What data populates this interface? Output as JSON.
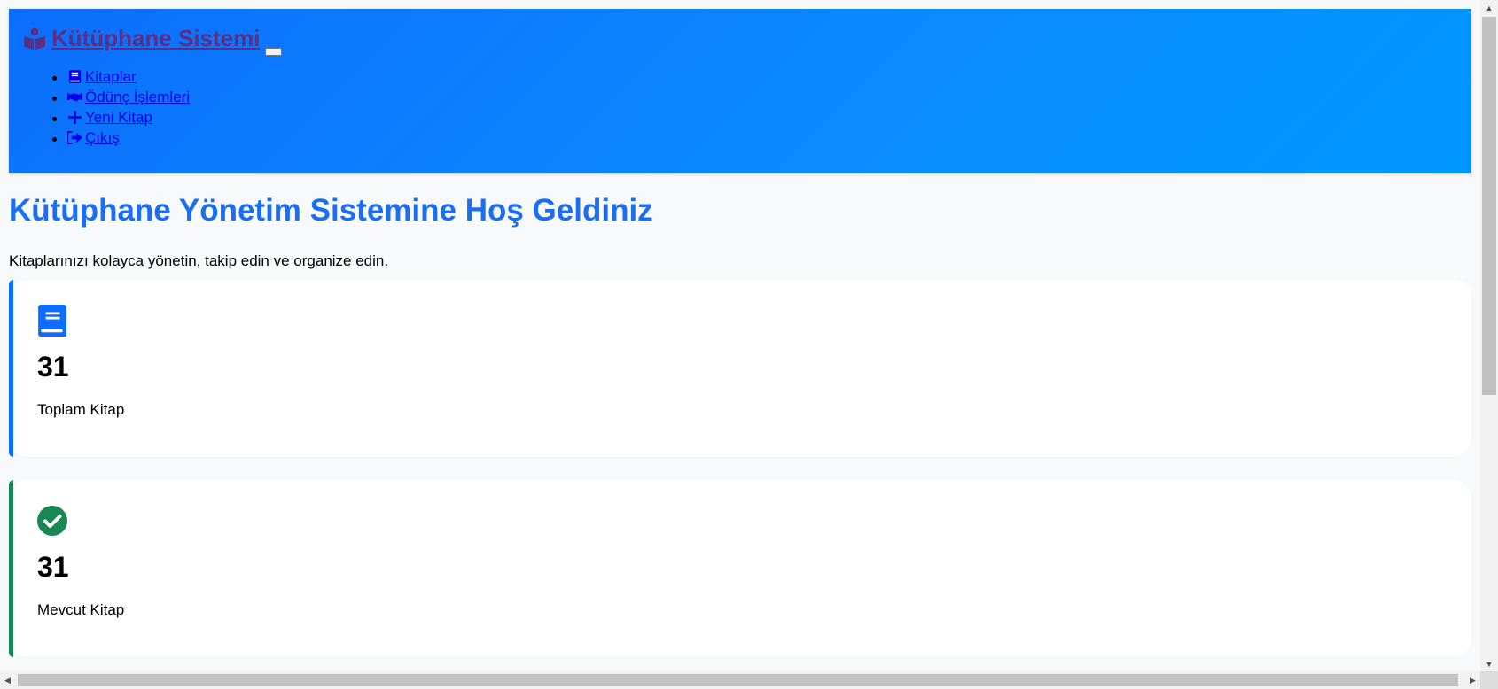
{
  "navbar": {
    "brand_label": "Kütüphane Sistemi",
    "brand_icon": "person-reading-icon",
    "items": [
      {
        "label": "Kitaplar",
        "icon": "book-icon"
      },
      {
        "label": "Ödünç İşlemleri",
        "icon": "handshake-icon"
      },
      {
        "label": "Yeni Kitap",
        "icon": "plus-icon"
      },
      {
        "label": "Çıkış",
        "icon": "sign-out-icon"
      }
    ]
  },
  "main": {
    "title": "Kütüphane Yönetim Sistemine Hoş Geldiniz",
    "subtitle": "Kitaplarınızı kolayca yönetin, takip edin ve organize edin."
  },
  "stats": [
    {
      "value": "31",
      "label": "Toplam Kitap",
      "icon": "book-icon",
      "accent": "#0d6efd"
    },
    {
      "value": "31",
      "label": "Mevcut Kitap",
      "icon": "check-circle-icon",
      "accent": "#198754"
    }
  ],
  "colors": {
    "navbar_start": "#0d6efd",
    "navbar_end": "#0096ff",
    "title": "#1a6ef2",
    "brand": "#5b2f86",
    "link": "#0000ee"
  }
}
